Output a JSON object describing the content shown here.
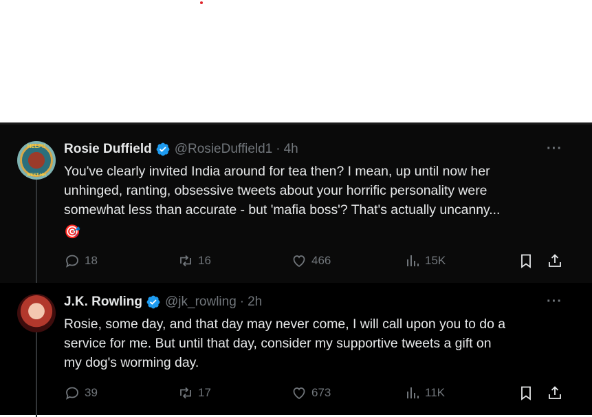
{
  "colors": {
    "feed_bg": "#000000",
    "text": "#e7e9ea",
    "muted": "#71767b",
    "verified": "#1d9bf0"
  },
  "tweets": [
    {
      "name": "Rosie Duffield",
      "handle": "@RosieDuffield1",
      "separator": "·",
      "time": "4h",
      "avatar_text_top": "HELP!!",
      "avatar_text_bottom": "WEST HH",
      "body_lines": [
        "You've clearly invited India around for tea then? I mean, up until now her",
        "unhinged, ranting, obsessive tweets about your horrific personality were",
        "somewhat less than accurate - but 'mafia boss'? That's actually uncanny..."
      ],
      "emoji": "🎯",
      "replies": "18",
      "reposts": "16",
      "likes": "466",
      "views": "15K"
    },
    {
      "name": "J.K. Rowling",
      "handle": "@jk_rowling",
      "separator": "·",
      "time": "2h",
      "body_lines": [
        "Rosie, some day, and that day may never come, I will call upon you to do a",
        "service for me. But until that day, consider my supportive tweets a gift on",
        "my dog's worming day."
      ],
      "replies": "39",
      "reposts": "17",
      "likes": "673",
      "views": "11K"
    }
  ],
  "more_label": "···"
}
